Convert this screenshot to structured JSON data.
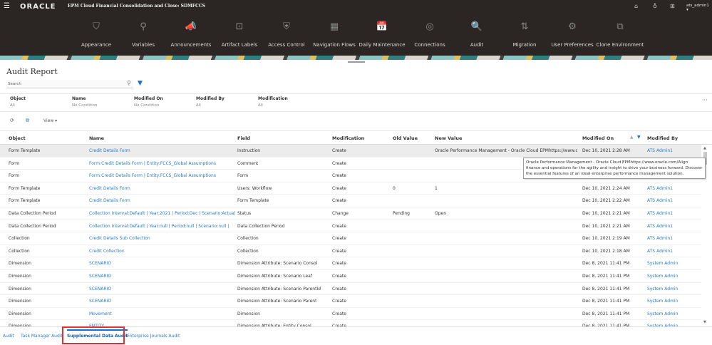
{
  "header": {
    "menu_icon": "hamburger-icon",
    "logo": "ORACLE",
    "app_title": "EPM Cloud Financial Consolidation and Close: SDMFCCS",
    "user": "ats_admin1 ▾",
    "icons": [
      "home-icon",
      "accessibility-icon",
      "apps-grid-icon"
    ]
  },
  "nav": [
    {
      "label": "Appearance",
      "icon": "⛉"
    },
    {
      "label": "Variables",
      "icon": "⚲"
    },
    {
      "label": "Announcements",
      "icon": "📣"
    },
    {
      "label": "Artifact Labels",
      "icon": "⊡"
    },
    {
      "label": "Access Control",
      "icon": "⛨"
    },
    {
      "label": "Navigation Flows",
      "icon": "▦"
    },
    {
      "label": "Daily Maintenance",
      "icon": "📅"
    },
    {
      "label": "Connections",
      "icon": "◎"
    },
    {
      "label": "Audit",
      "icon": "🔍"
    },
    {
      "label": "Migration",
      "icon": "⇅"
    },
    {
      "label": "User Preferences",
      "icon": "⚙"
    },
    {
      "label": "Clone Environment",
      "icon": "⧉"
    }
  ],
  "page": {
    "title": "Audit Report",
    "search_placeholder": "Search"
  },
  "filters": [
    {
      "label": "Object",
      "value": "All"
    },
    {
      "label": "Name",
      "value": "No Condition"
    },
    {
      "label": "Modified On",
      "value": "No Condition"
    },
    {
      "label": "Modified By",
      "value": "All"
    },
    {
      "label": "Modification",
      "value": "All"
    }
  ],
  "toolbar": {
    "view_label": "View ▾",
    "more": "···"
  },
  "columns": [
    "Object",
    "Name",
    "Field",
    "Modification",
    "Old Value",
    "New Value",
    "Modified On",
    "Modified By"
  ],
  "rows": [
    [
      "Form Template",
      "Credit Details Form",
      "Instruction",
      "Create",
      "",
      "Oracle Performance Management - Oracle Cloud EPMhttps://www.o...",
      "Dec 10, 2021 2:28 AM",
      "ATS Admin1"
    ],
    [
      "Form",
      "Form:Credit Details Form | Entity:FCCS_Global Assumptions",
      "Comment",
      "Create",
      "",
      "",
      "",
      ""
    ],
    [
      "Form",
      "Form:Credit Details Form | Entity:FCCS_Global Assumptions",
      "Form",
      "Create",
      "",
      "",
      "",
      ""
    ],
    [
      "Form Template",
      "Credit Details Form",
      "Users: Workflow",
      "Create",
      "0",
      "1",
      "Dec 10, 2021 2:24 AM",
      "ATS Admin1"
    ],
    [
      "Form Template",
      "Credit Details Form",
      "Form Template",
      "Create",
      "",
      "",
      "Dec 10, 2021 2:22 AM",
      "ATS Admin1"
    ],
    [
      "Data Collection Period",
      "Collection Interval:Default | Year:2021 | Period:Dec | Scenario:Actual |",
      "Status",
      "Change",
      "Pending",
      "Open",
      "Dec 10, 2021 2:21 AM",
      "ATS Admin1"
    ],
    [
      "Data Collection Period",
      "Collection Interval:Default | Year:null | Period:null | Scenario:null |",
      "Data Collection Period",
      "Create",
      "",
      "",
      "Dec 10, 2021 2:21 AM",
      "ATS Admin1"
    ],
    [
      "Collection",
      "Credit Details Sub Collection",
      "Collection",
      "Create",
      "",
      "",
      "Dec 10, 2021 2:19 AM",
      "ATS Admin1"
    ],
    [
      "Collection",
      "Credit Collection",
      "Collection",
      "Create",
      "",
      "",
      "Dec 10, 2021 2:18 AM",
      "ATS Admin1"
    ],
    [
      "Dimension",
      "SCENARIO",
      "Dimension Attribute: Scenario Consol",
      "Create",
      "",
      "",
      "Dec 8, 2021 11:41 PM",
      "System Admin"
    ],
    [
      "Dimension",
      "SCENARIO",
      "Dimension Attribute: Scenario Leaf",
      "Create",
      "",
      "",
      "Dec 8, 2021 11:41 PM",
      "System Admin"
    ],
    [
      "Dimension",
      "SCENARIO",
      "Dimension Attribute: Scenario ParentId",
      "Create",
      "",
      "",
      "Dec 8, 2021 11:41 PM",
      "System Admin"
    ],
    [
      "Dimension",
      "SCENARIO",
      "Dimension Attribute: Scenario Parent",
      "Create",
      "",
      "",
      "Dec 8, 2021 11:41 PM",
      "System Admin"
    ],
    [
      "Dimension",
      "Movement",
      "Dimension",
      "Create",
      "",
      "",
      "Dec 8, 2021 11:41 PM",
      "System Admin"
    ],
    [
      "Dimension",
      "ENTITY",
      "Dimension Attribute: Entity Consol",
      "Create",
      "",
      "",
      "Dec 8, 2021 11:41 PM",
      "System Admin"
    ]
  ],
  "tooltip": "Oracle Performance Management - Oracle Cloud EPMhttps://www.oracle.com/Align finance and operations for the agility and insight to drive your business forward. Discover the essential features of an ideal enterprise performance management solution.",
  "tabs": [
    {
      "label": "Audit"
    },
    {
      "label": "Task Manager Audit"
    },
    {
      "label": "Supplemental Data Audit",
      "active": true
    },
    {
      "label": "Enterprise Journals Audit"
    }
  ],
  "colors": {
    "accent": "#1a6fc9",
    "link": "#2a7bc4",
    "header_bg": "#2b2623",
    "highlight": "#e03030"
  }
}
